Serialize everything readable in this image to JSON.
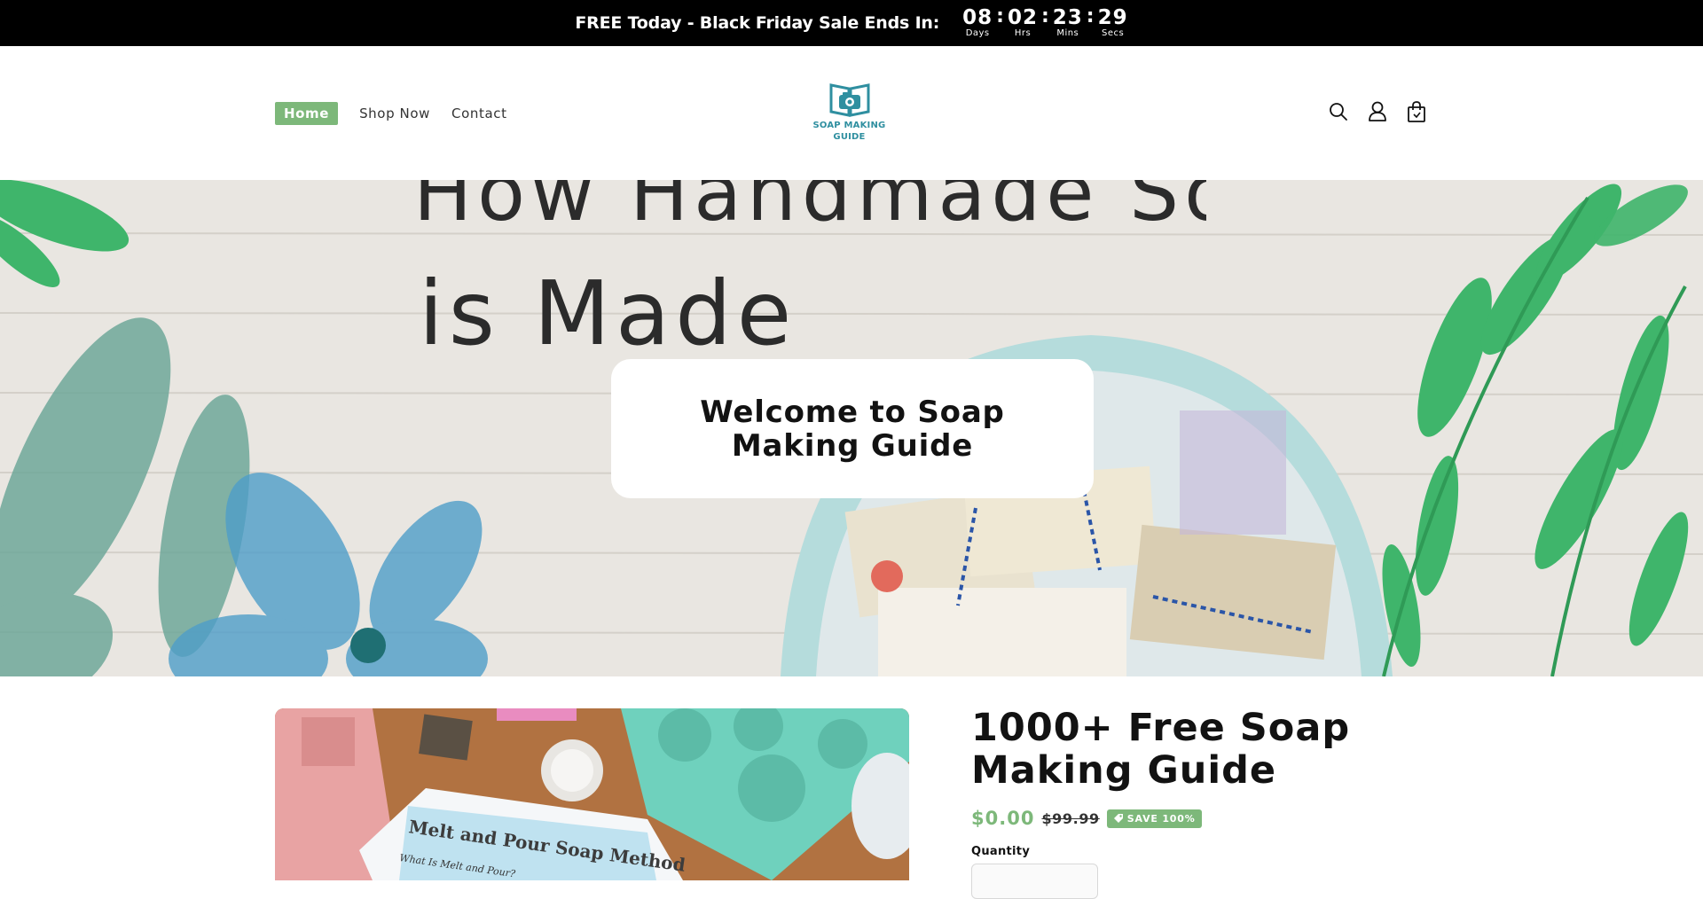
{
  "announcement": {
    "text": "FREE Today - Black Friday Sale Ends In:",
    "countdown": [
      {
        "value": "08",
        "label": "Days"
      },
      {
        "value": "02",
        "label": "Hrs"
      },
      {
        "value": "23",
        "label": "Mins"
      },
      {
        "value": "29",
        "label": "Secs"
      }
    ],
    "separator": ":"
  },
  "header": {
    "nav": [
      {
        "label": "Home",
        "active": true
      },
      {
        "label": "Shop Now",
        "active": false
      },
      {
        "label": "Contact",
        "active": false
      }
    ],
    "logo_text_line1": "SOAP MAKING",
    "logo_text_line2": "GUIDE",
    "icons": [
      "search-icon",
      "account-icon",
      "cart-icon"
    ]
  },
  "hero": {
    "background_text_line1": "How Handmade Soap",
    "background_text_line2": "is Made",
    "title": "Welcome to Soap Making Guide"
  },
  "product": {
    "title": "1000+ Free Soap Making Guide",
    "price": "$0.00",
    "compare_price": "$99.99",
    "badge": "SAVE 100%",
    "quantity_label": "Quantity",
    "image_text": "Melt and Pour Soap Method",
    "image_subtext": "What Is Melt and Pour?"
  },
  "colors": {
    "accent_green": "#7db87a",
    "logo_teal": "#2f8fa0",
    "announcement_bg": "#000000"
  }
}
